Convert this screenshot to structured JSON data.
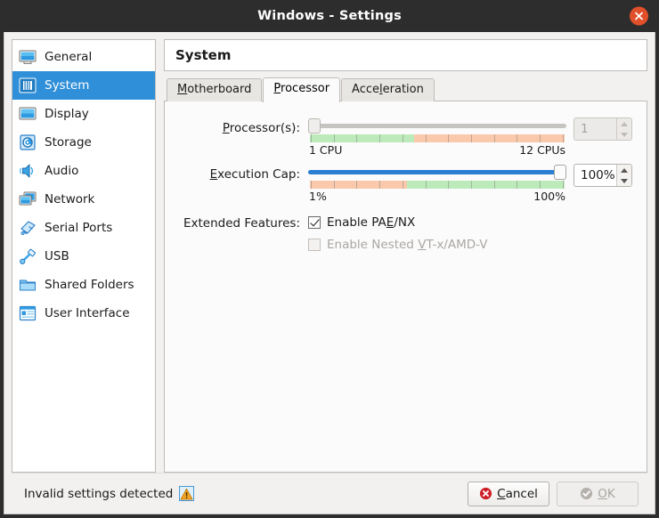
{
  "window": {
    "title": "Windows - Settings",
    "close_icon": "close-icon",
    "close_color": "#e2502b"
  },
  "sidebar": {
    "items": [
      {
        "label": "General",
        "icon": "monitor-icon",
        "selected": false
      },
      {
        "label": "System",
        "icon": "cpu-chip-icon",
        "selected": true
      },
      {
        "label": "Display",
        "icon": "display-icon",
        "selected": false
      },
      {
        "label": "Storage",
        "icon": "hard-disk-icon",
        "selected": false
      },
      {
        "label": "Audio",
        "icon": "speaker-icon",
        "selected": false
      },
      {
        "label": "Network",
        "icon": "network-cards-icon",
        "selected": false
      },
      {
        "label": "Serial Ports",
        "icon": "serial-port-icon",
        "selected": false
      },
      {
        "label": "USB",
        "icon": "usb-plug-icon",
        "selected": false
      },
      {
        "label": "Shared Folders",
        "icon": "folder-icon",
        "selected": false
      },
      {
        "label": "User Interface",
        "icon": "window-layout-icon",
        "selected": false
      }
    ],
    "selected_accent": "#2f8fd8"
  },
  "pane": {
    "title": "System",
    "tabs": [
      {
        "label": "Motherboard",
        "mnemonic": "M",
        "active": false
      },
      {
        "label": "Processor",
        "mnemonic": "P",
        "active": true
      },
      {
        "label": "Acceleration",
        "mnemonic": "l",
        "active": false
      }
    ]
  },
  "processor_tab": {
    "processors": {
      "label_pre": "",
      "label_mnemonic": "P",
      "label_post": "rocessor(s):",
      "min_label": "1 CPU",
      "max_label": "12 CPUs",
      "value": "1",
      "slider_percent": 0,
      "enabled": false,
      "bar_green_percent": 41,
      "bar_green_color": "#bdeaba",
      "bar_orange_color": "#fac9ab"
    },
    "execution_cap": {
      "label_pre": "",
      "label_mnemonic": "E",
      "label_post": "xecution Cap:",
      "min_label": "1%",
      "max_label": "100%",
      "value": "100%",
      "slider_percent": 100,
      "enabled": true,
      "bar_orange_percent": 38,
      "bar_orange_color": "#fac9ab",
      "bar_green_color": "#bdeaba",
      "fill_color": "#2a7fd4"
    },
    "extended_features": {
      "label": "Extended Features:",
      "options": [
        {
          "label_pre": "Enable PA",
          "mnemonic": "E",
          "label_post": "/NX",
          "checked": true,
          "enabled": true
        },
        {
          "label_pre": "Enable Nested ",
          "mnemonic": "V",
          "label_post": "T-x/AMD-V",
          "checked": false,
          "enabled": false
        }
      ]
    }
  },
  "footer": {
    "status_text": "Invalid settings detected",
    "status_icon": "warning-triangle-icon",
    "cancel": {
      "pre": "",
      "mnemonic": "C",
      "post": "ancel",
      "icon": "cancel-x-icon",
      "enabled": true
    },
    "ok": {
      "pre": "",
      "mnemonic": "O",
      "post": "K",
      "icon": "ok-check-icon",
      "enabled": false
    }
  }
}
